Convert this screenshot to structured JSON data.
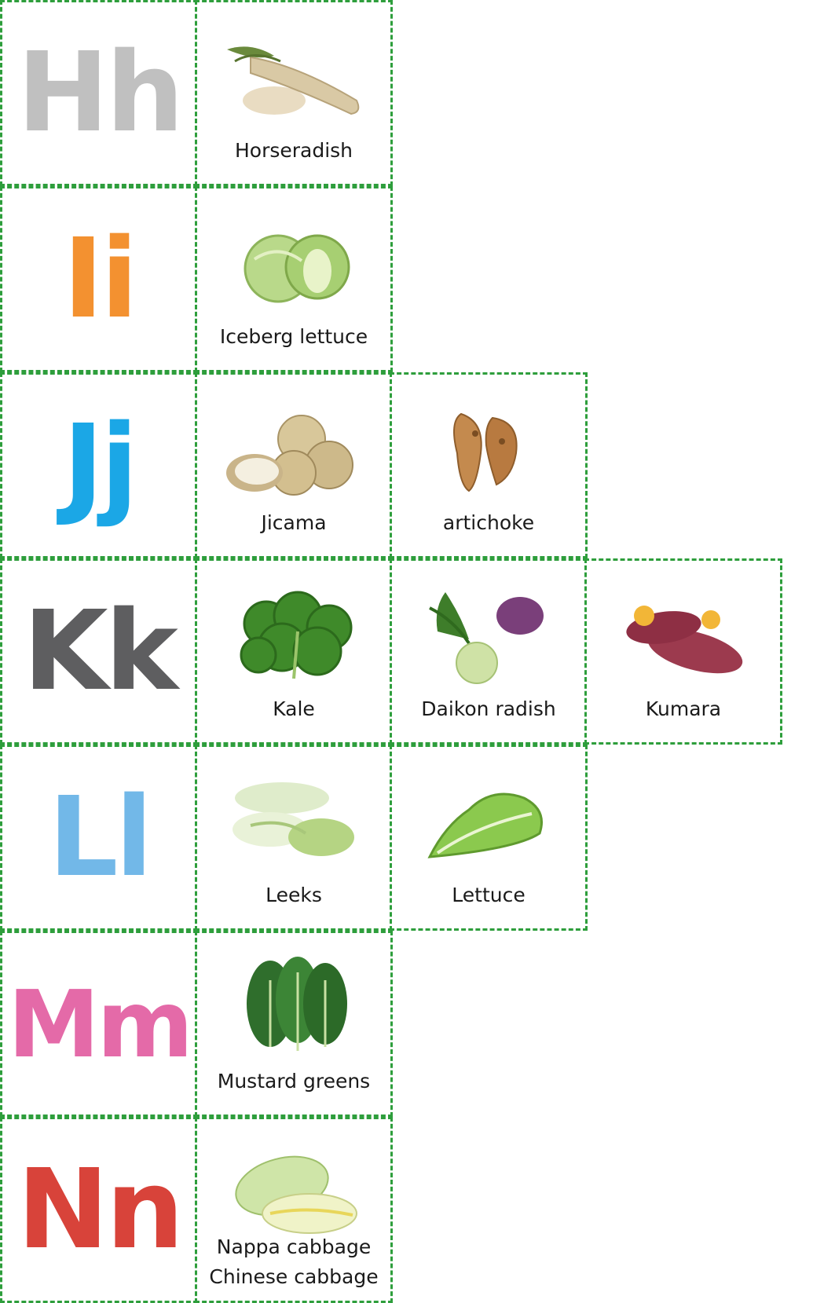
{
  "rows": [
    {
      "letter": "Hh",
      "letter_color": "#c0c0c0",
      "items": [
        {
          "label": "Horseradish",
          "icon": "horseradish-icon"
        }
      ]
    },
    {
      "letter": "Ii",
      "letter_color": "#f39130",
      "items": [
        {
          "label": "Iceberg lettuce",
          "icon": "iceberg-lettuce-icon"
        }
      ]
    },
    {
      "letter": "Jj",
      "letter_color": "#1ba7e6",
      "items": [
        {
          "label": "Jicama",
          "icon": "jicama-icon"
        },
        {
          "label": "artichoke",
          "icon": "artichoke-icon"
        }
      ]
    },
    {
      "letter": "Kk",
      "letter_color": "#5e5e60",
      "items": [
        {
          "label": "Kale",
          "icon": "kale-icon"
        },
        {
          "label": "Daikon radish",
          "icon": "daikon-radish-icon"
        },
        {
          "label": "Kumara",
          "icon": "kumara-icon"
        }
      ]
    },
    {
      "letter": "Ll",
      "letter_color": "#72b8e8",
      "items": [
        {
          "label": "Leeks",
          "icon": "leeks-icon"
        },
        {
          "label": "Lettuce",
          "icon": "lettuce-icon"
        }
      ]
    },
    {
      "letter": "Mm",
      "letter_color": "#e46aa8",
      "items": [
        {
          "label": "Mustard greens",
          "icon": "mustard-greens-icon"
        }
      ]
    },
    {
      "letter": "Nn",
      "letter_color": "#d8433a",
      "items": [
        {
          "label": "Nappa cabbage\nChinese cabbage",
          "icon": "nappa-cabbage-icon"
        }
      ]
    }
  ]
}
